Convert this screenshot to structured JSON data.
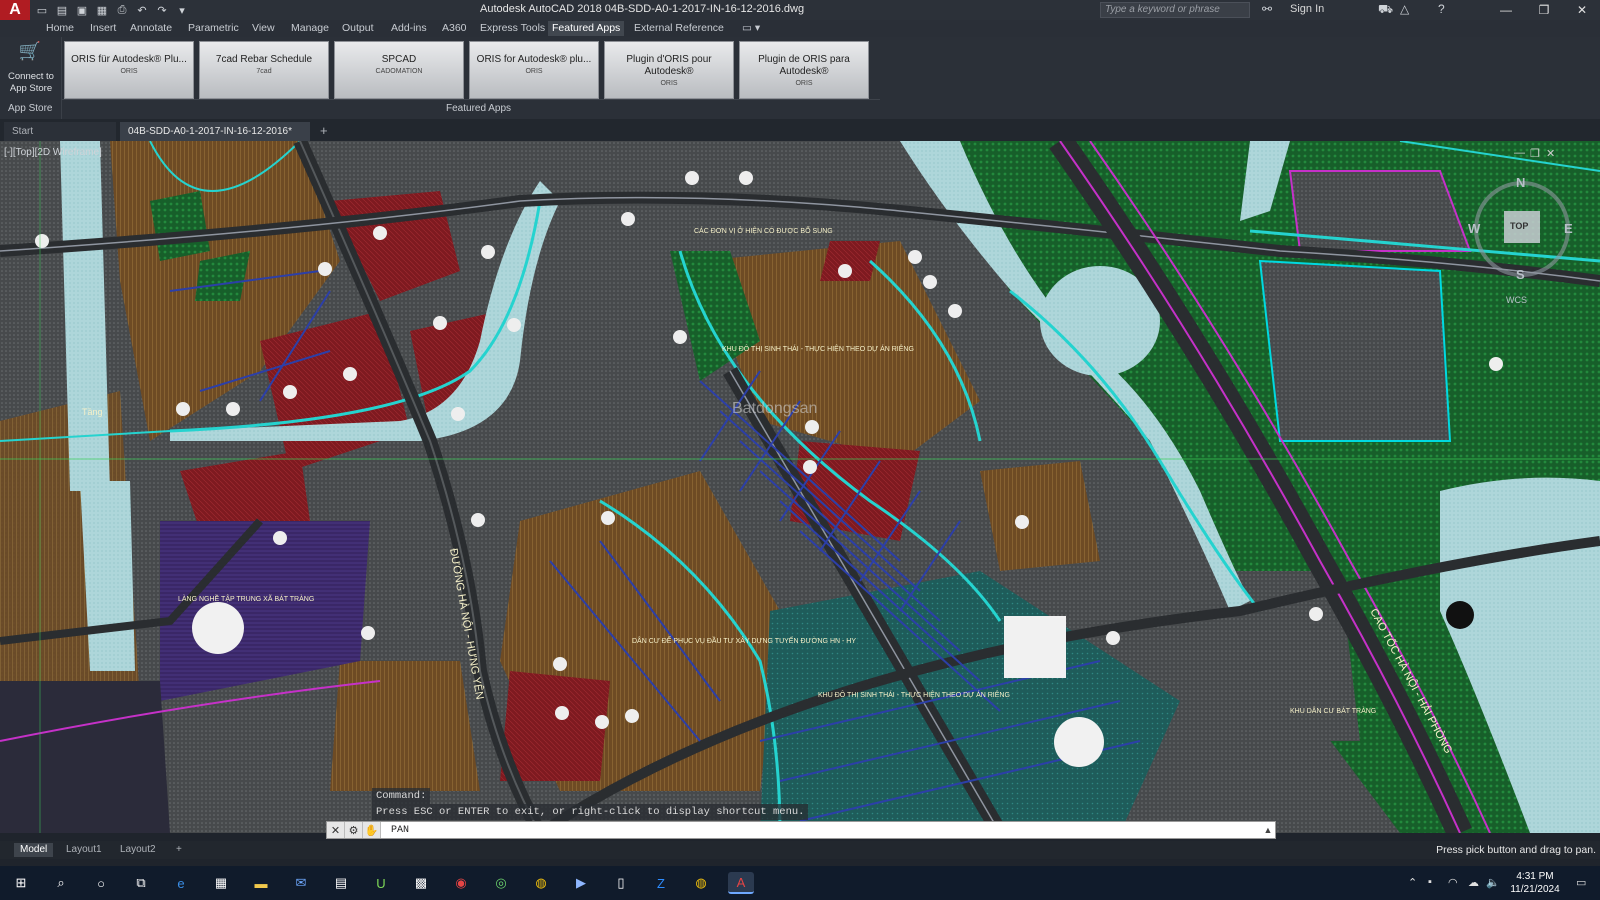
{
  "titlebar": {
    "app_logo": "A",
    "title": "Autodesk AutoCAD 2018    04B-SDD-A0-1-2017-IN-16-12-2016.dwg",
    "search_placeholder": "Type a keyword or phrase",
    "sign_in": "Sign In",
    "quick_access_icons": [
      "new-icon",
      "open-icon",
      "save-icon",
      "save-as-icon",
      "print-icon",
      "undo-icon",
      "redo-icon",
      "dropdown-icon"
    ]
  },
  "ribbon_tabs": [
    "Home",
    "Insert",
    "Annotate",
    "Parametric",
    "View",
    "Manage",
    "Output",
    "Add-ins",
    "A360",
    "Express Tools",
    "Featured Apps",
    "External Reference"
  ],
  "ribbon_active_tab": "Featured Apps",
  "app_store": {
    "label": "Connect to App Store",
    "caption": "App Store"
  },
  "featured_apps": [
    {
      "title": "ORIS für Autodesk® Plu...",
      "vendor": "ORIS"
    },
    {
      "title": "7cad Rebar Schedule",
      "vendor": "7cad"
    },
    {
      "title": "SPCAD",
      "vendor": "CADOMATION"
    },
    {
      "title": "ORIS for Autodesk® plu...",
      "vendor": "ORIS"
    },
    {
      "title": "Plugin d'ORIS pour Autodesk®",
      "vendor": "ORIS"
    },
    {
      "title": "Plugin de ORIS para Autodesk®",
      "vendor": "ORIS"
    }
  ],
  "featured_caption": "Featured Apps",
  "document_tabs": [
    {
      "label": "Start"
    },
    {
      "label": "04B-SDD-A0-1-2017-IN-16-12-2016*"
    }
  ],
  "viewport": {
    "label": "[-][Top][2D Wireframe]",
    "viewcube": {
      "n": "N",
      "s": "S",
      "e": "E",
      "w": "W",
      "face": "TOP",
      "wcs": "WCS"
    }
  },
  "map_labels": [
    "ĐƯỜNG HÀ NỘI - HƯNG YÊN",
    "CAO TỐC HÀ NỘI - HẢI PHÒNG",
    "CÁC ĐƠN VỊ Ở HIỆN CÓ ĐƯỢC BỔ SUNG",
    "KHU ĐÔ THỊ SINH THÁI - THỰC HIỆN THEO DỰ ÁN RIÊNG",
    "LÀNG NGHỀ TẬP TRUNG XÃ BÁT TRÀNG",
    "DÂN CƯ ĐỂ PHỤC VỤ ĐẦU TƯ XÂY DỰNG TUYẾN ĐƯỜNG HN - HY",
    "KHU ĐÔ THỊ SINH THÁI - THỰC HIỆN THEO DỰ ÁN RIÊNG",
    "KHU DÂN CƯ BÁT TRÀNG",
    "Batdongsan",
    "Tầng"
  ],
  "command": {
    "history": [
      "Command:",
      "Press ESC or ENTER to exit, or right-click to display shortcut menu."
    ],
    "input": "PAN"
  },
  "layout_tabs": [
    "Model",
    "Layout1",
    "Layout2"
  ],
  "layout_active": "Model",
  "status_message": "Press pick button and drag to pan.",
  "taskbar": {
    "icons": [
      "windows-icon",
      "search-icon",
      "cortana-icon",
      "task-view-icon",
      "edge-icon",
      "store-icon",
      "explorer-icon",
      "mail-icon",
      "calculator-icon",
      "app-u-icon",
      "app-grid-icon",
      "app-red-icon",
      "app-green-icon",
      "chrome-icon",
      "media-icon",
      "file-icon",
      "zalo-icon",
      "chrome2-icon",
      "autocad-icon"
    ],
    "time": "4:31 PM",
    "date": "11/21/2024"
  },
  "colors": {
    "residential_brown": "#7a5328",
    "red_block": "#8b1a1f",
    "green_space": "#1a6b2e",
    "water": "#b9dce0",
    "road_cyan": "#25d3cf",
    "road_magenta": "#c531c8",
    "purple_block": "#3d2a6e",
    "gray_block": "#4b4e4f"
  }
}
